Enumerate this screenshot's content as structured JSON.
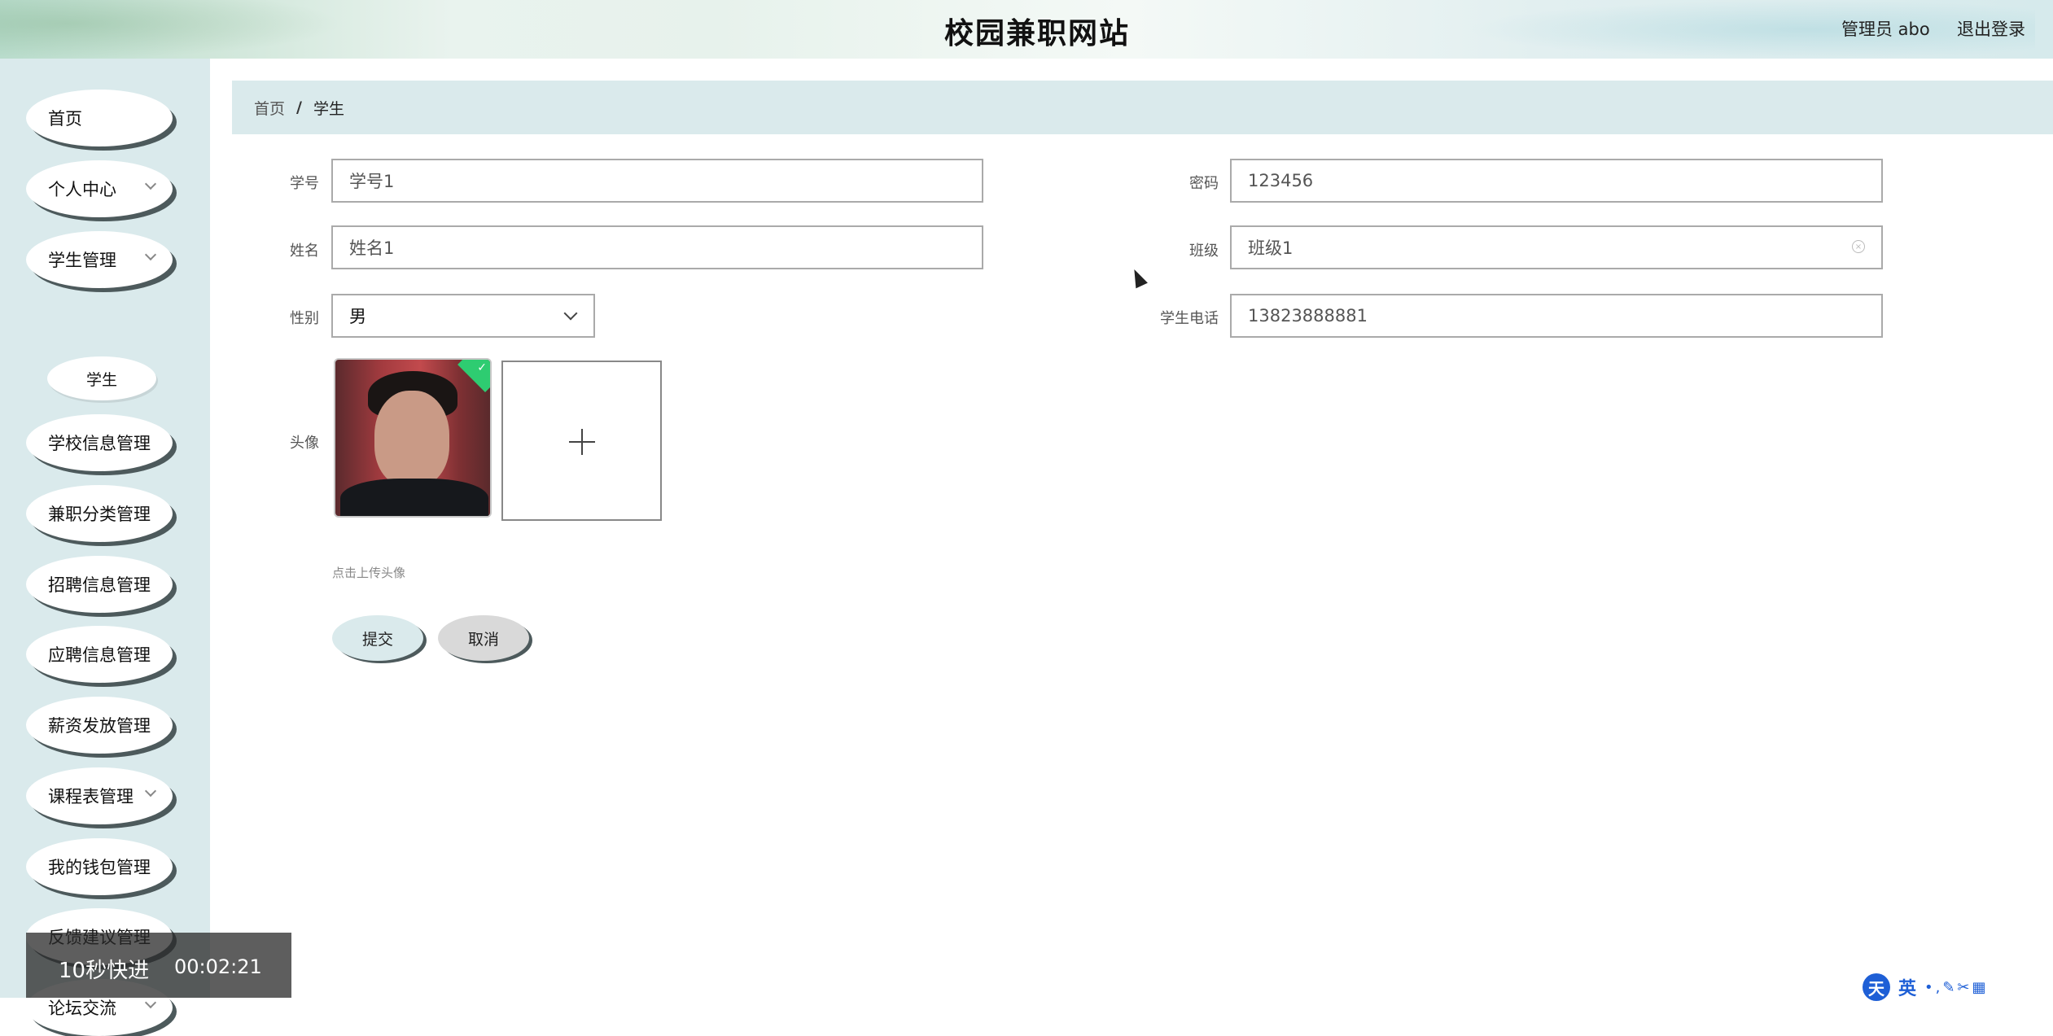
{
  "header": {
    "title": "校园兼职网站",
    "user": "管理员 abo",
    "logout": "退出登录"
  },
  "sidebar": {
    "items": [
      {
        "label": "首页",
        "has_chevron": false
      },
      {
        "label": "个人中心",
        "has_chevron": true
      },
      {
        "label": "学生管理",
        "has_chevron": true
      },
      {
        "label": "学校信息管理",
        "has_chevron": false
      },
      {
        "label": "兼职分类管理",
        "has_chevron": false
      },
      {
        "label": "招聘信息管理",
        "has_chevron": false
      },
      {
        "label": "应聘信息管理",
        "has_chevron": false
      },
      {
        "label": "薪资发放管理",
        "has_chevron": false
      },
      {
        "label": "课程表管理",
        "has_chevron": true
      },
      {
        "label": "我的钱包管理",
        "has_chevron": false
      },
      {
        "label": "反馈建议管理",
        "has_chevron": false
      },
      {
        "label": "论坛交流",
        "has_chevron": true
      }
    ],
    "sub_item": "学生"
  },
  "breadcrumb": {
    "home": "首页",
    "separator": "/",
    "current": "学生"
  },
  "form": {
    "student_id": {
      "label": "学号",
      "value": "学号1"
    },
    "password": {
      "label": "密码",
      "value": "123456"
    },
    "name": {
      "label": "姓名",
      "value": "姓名1"
    },
    "class": {
      "label": "班级",
      "value": "班级1"
    },
    "gender": {
      "label": "性别",
      "value": "男"
    },
    "phone": {
      "label": "学生电话",
      "value": "13823888881"
    },
    "avatar": {
      "label": "头像",
      "hint": "点击上传头像"
    },
    "submit": "提交",
    "cancel": "取消"
  },
  "overlay": {
    "fast_forward": "10秒快进",
    "time": "00:02:21"
  },
  "ime": {
    "logo": "天",
    "mode": "英"
  },
  "colors": {
    "sidebar_bg": "#daeaec",
    "shadow": "#4d5a5c",
    "ime_blue": "#1e5fd6",
    "checkmark": "#2ecc71"
  }
}
